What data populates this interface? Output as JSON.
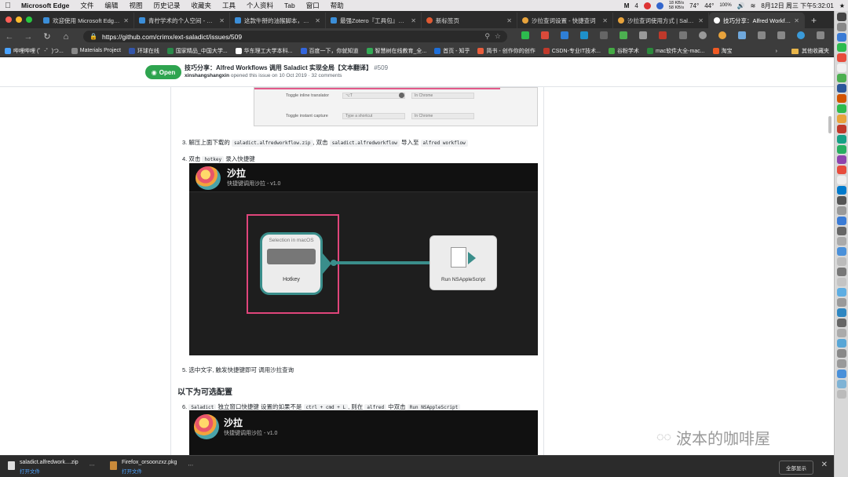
{
  "menubar": {
    "app": "Microsoft Edge",
    "items": [
      "文件",
      "编辑",
      "视图",
      "历史记录",
      "收藏夹",
      "工具",
      "个人资料",
      "Tab",
      "窗口",
      "帮助"
    ],
    "net_up": "18 KB/s",
    "net_down": "58 KB/s",
    "temp": "74°",
    "temp2": "44°",
    "battery": "100%",
    "clock": "8月12日 周三 下午5:32:01",
    "badge": "4"
  },
  "tabs": [
    {
      "label": "欢迎使用 Microsoft Edge C",
      "color": "#3b8ed8"
    },
    {
      "label": "青柠学术的个人空间 - 哔哩",
      "color": "#3b8ed8"
    },
    {
      "label": "这款牛掰的油猴脚本，让照",
      "color": "#3b8ed8"
    },
    {
      "label": "最强Zotero『工具包』已更",
      "color": "#3b8ed8"
    },
    {
      "label": "新标签页",
      "color": "#e05a33"
    },
    {
      "label": "沙拉查词设置 - 快捷查词",
      "color": "#e8a33c"
    },
    {
      "label": "沙拉查词使用方式 | Saladic",
      "color": "#e8a33c"
    },
    {
      "label": "技巧分享：Alfred Workflow",
      "color": "#ffffff"
    }
  ],
  "address": {
    "url": "https://github.com/crimx/ext-saladict/issues/509"
  },
  "bookmarks": [
    {
      "label": "哔哩哔哩 (゜-゜)つ...",
      "color": "#4aa3ff"
    },
    {
      "label": "Materials Project",
      "color": "#888888"
    },
    {
      "label": "环球在线",
      "color": "#3355aa"
    },
    {
      "label": "国家精品_中国大学...",
      "color": "#2a8a4a"
    },
    {
      "label": "华东理工大学本科...",
      "color": "#ffffff"
    },
    {
      "label": "百度一下，你就知道",
      "color": "#3366dd"
    },
    {
      "label": "智慧树在线教育_全...",
      "color": "#33aa55"
    },
    {
      "label": "首页 - 知乎",
      "color": "#1e6fd9"
    },
    {
      "label": "简书 - 创作你的创作",
      "color": "#e95d3c"
    },
    {
      "label": "CSDN-专业IT技术...",
      "color": "#c0392b"
    },
    {
      "label": "谷粉学术",
      "color": "#44aa44"
    },
    {
      "label": "mac软件大全-mac...",
      "color": "#2c8a3c"
    },
    {
      "label": "淘宝",
      "color": "#f05a24"
    }
  ],
  "bookmarks_other": "其他收藏夹",
  "issue": {
    "state": "Open",
    "title": "技巧分享：Alfred Workflows 调用 Saladict 实现全局【文本翻译】",
    "number": "#509",
    "author": "xinshangshangxin",
    "meta_rest": "opened this issue on 10 Oct 2019 · 32 comments"
  },
  "shot1": {
    "row1_label": "Toggle inline translator",
    "row1_value": "⌥T",
    "row1_scope": "In Chrome",
    "row2_label": "Toggle instant capture",
    "row2_value": "Type a shortcut",
    "row2_scope": "In Chrome"
  },
  "steps": {
    "s3": {
      "num": "3.",
      "t1": "解压上面下载的",
      "c1": "saladict.alfredworkflow.zip",
      "t2": ", 双击",
      "c2": "saladict.alfredworkflow",
      "t3": "导入至",
      "c3": "alfred workflow"
    },
    "s4": {
      "num": "4.",
      "t1": "双击",
      "c1": "hotkey",
      "t2": "录入快捷键"
    },
    "s5": {
      "num": "5.",
      "t1": "选中文字, 触发快捷键即可 调用沙拉查询"
    },
    "s6": {
      "num": "6.",
      "c1": "Saladict",
      "t1": "独立窗口快捷键",
      "t2": "设置的如果不是",
      "c2": "ctrl + cmd + L",
      "t3": ", 则在",
      "c3": "alfred",
      "t4": "中双击",
      "c4": "Run NSAppleScript"
    }
  },
  "optional_heading": "以下为可选配置",
  "workflow": {
    "app_title": "沙拉",
    "app_subtitle": "快捷键调用沙拉 - v1.0",
    "trigger_tag": "Selection in macOS",
    "trigger_label": "Hotkey",
    "action_label": "Run NSAppleScript"
  },
  "workflow2": {
    "app_title": "沙拉",
    "app_subtitle": "快捷键调用沙拉 - v1.0"
  },
  "watermark": "波本的咖啡屋",
  "downloads": [
    {
      "name": "saladict.alfredwork....zip",
      "action": "打开文件"
    },
    {
      "name": "Firefox_orsoonzxz.pkg",
      "action": "打开文件"
    }
  ],
  "show_all": "全部显示",
  "colors": {
    "open_green": "#2ea44f",
    "highlight_pink": "#e0457b",
    "node_teal": "#3a8e8b",
    "link_blue": "#4ea3ff"
  }
}
